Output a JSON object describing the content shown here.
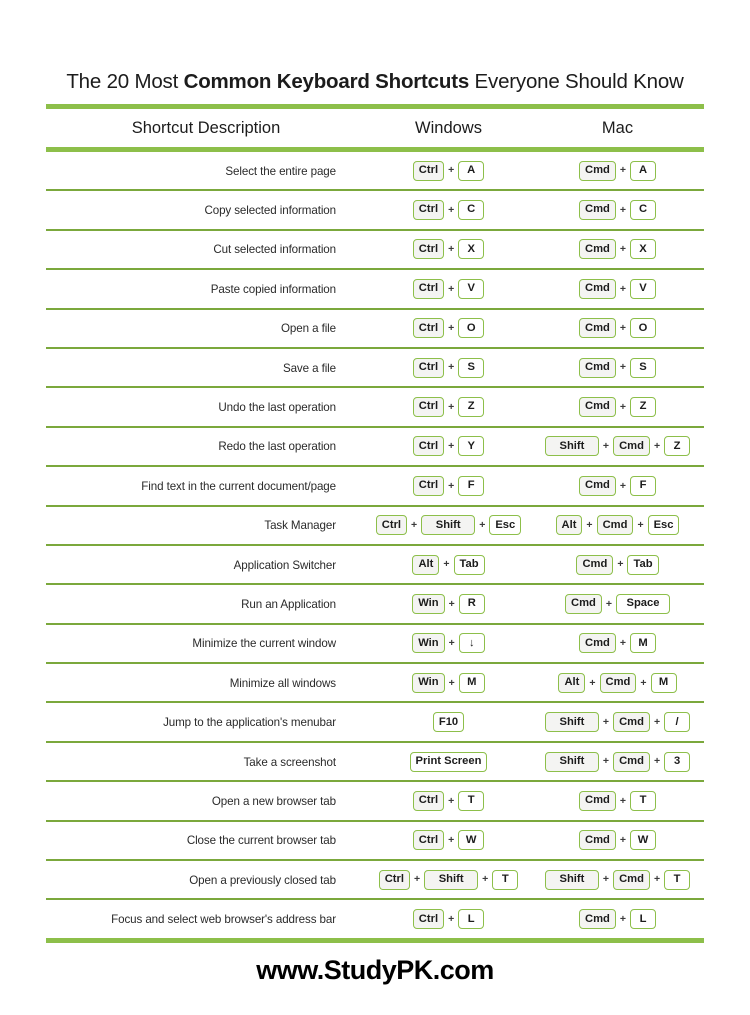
{
  "title": {
    "part1": "The 20 Most ",
    "part2": "Common Keyboard Shortcuts",
    "part3": " Everyone Should Know"
  },
  "colors": {
    "accent_bar": "#8dbf4a",
    "row_divider": "#7ba83c",
    "key_border": "#8dbf4a",
    "key_modifier_fill": "#f4f4f2",
    "text": "#1c1c1c"
  },
  "header": {
    "description": "Shortcut Description",
    "windows": "Windows",
    "mac": "Mac"
  },
  "separator": "+",
  "rows": [
    {
      "description": "Select the entire page",
      "windows": [
        "Ctrl",
        "A"
      ],
      "mac": [
        "Cmd",
        "A"
      ]
    },
    {
      "description": "Copy selected information",
      "windows": [
        "Ctrl",
        "C"
      ],
      "mac": [
        "Cmd",
        "C"
      ]
    },
    {
      "description": "Cut selected information",
      "windows": [
        "Ctrl",
        "X"
      ],
      "mac": [
        "Cmd",
        "X"
      ]
    },
    {
      "description": "Paste copied information",
      "windows": [
        "Ctrl",
        "V"
      ],
      "mac": [
        "Cmd",
        "V"
      ]
    },
    {
      "description": "Open a file",
      "windows": [
        "Ctrl",
        "O"
      ],
      "mac": [
        "Cmd",
        "O"
      ]
    },
    {
      "description": "Save a file",
      "windows": [
        "Ctrl",
        "S"
      ],
      "mac": [
        "Cmd",
        "S"
      ]
    },
    {
      "description": "Undo the last operation",
      "windows": [
        "Ctrl",
        "Z"
      ],
      "mac": [
        "Cmd",
        "Z"
      ]
    },
    {
      "description": "Redo the last operation",
      "windows": [
        "Ctrl",
        "Y"
      ],
      "mac": [
        "Shift",
        "Cmd",
        "Z"
      ]
    },
    {
      "description": "Find text in the current document/page",
      "windows": [
        "Ctrl",
        "F"
      ],
      "mac": [
        "Cmd",
        "F"
      ]
    },
    {
      "description": "Task Manager",
      "windows": [
        "Ctrl",
        "Shift",
        "Esc"
      ],
      "mac": [
        "Alt",
        "Cmd",
        "Esc"
      ]
    },
    {
      "description": "Application Switcher",
      "windows": [
        "Alt",
        "Tab"
      ],
      "mac": [
        "Cmd",
        "Tab"
      ]
    },
    {
      "description": "Run an Application",
      "windows": [
        "Win",
        "R"
      ],
      "mac": [
        "Cmd",
        "Space"
      ]
    },
    {
      "description": "Minimize the current window",
      "windows": [
        "Win",
        "↓"
      ],
      "mac": [
        "Cmd",
        "M"
      ]
    },
    {
      "description": "Minimize all windows",
      "windows": [
        "Win",
        "M"
      ],
      "mac": [
        "Alt",
        "Cmd",
        "M"
      ]
    },
    {
      "description": "Jump to the application's menubar",
      "windows": [
        "F10"
      ],
      "mac": [
        "Shift",
        "Cmd",
        "/"
      ]
    },
    {
      "description": "Take a screenshot",
      "windows": [
        "Print Screen"
      ],
      "mac": [
        "Shift",
        "Cmd",
        "3"
      ]
    },
    {
      "description": "Open a new browser tab",
      "windows": [
        "Ctrl",
        "T"
      ],
      "mac": [
        "Cmd",
        "T"
      ]
    },
    {
      "description": "Close the current browser tab",
      "windows": [
        "Ctrl",
        "W"
      ],
      "mac": [
        "Cmd",
        "W"
      ]
    },
    {
      "description": "Open a previously closed tab",
      "windows": [
        "Ctrl",
        "Shift",
        "T"
      ],
      "mac": [
        "Shift",
        "Cmd",
        "T"
      ]
    },
    {
      "description": "Focus and select web browser's address bar",
      "windows": [
        "Ctrl",
        "L"
      ],
      "mac": [
        "Cmd",
        "L"
      ]
    }
  ],
  "footer": {
    "site": "www.StudyPK.com"
  }
}
